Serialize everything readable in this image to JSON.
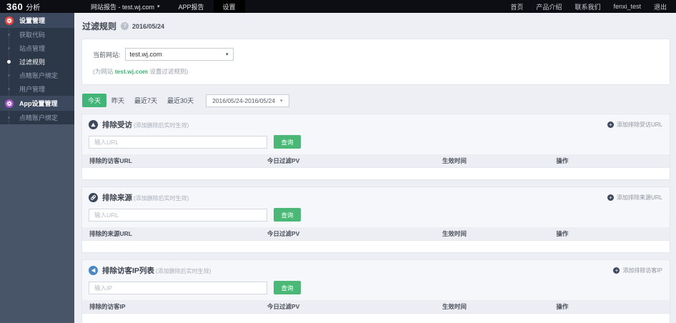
{
  "glyphs": {
    "caret": "▾",
    "question": "?",
    "plus": "+"
  },
  "colors": {
    "accent_green": "#44b478",
    "settings_gear": "#e8483f",
    "app_gear": "#a653c9",
    "section1_icon": "#3c485d",
    "section2_icon": "#3c485d",
    "section3_icon": "#4a87c7"
  },
  "topbar": {
    "logo_brand": "360",
    "logo_suffix": "分析",
    "nav": [
      {
        "label": "网站报告 - test.wj.com"
      },
      {
        "label": "APP报告"
      },
      {
        "label": "设置"
      }
    ],
    "links": [
      "首页",
      "产品介绍",
      "联系我们",
      "fenxi_test",
      "退出"
    ]
  },
  "sidebar": {
    "groups": [
      {
        "header": "设置管理",
        "items": [
          "获取代码",
          "站点管理",
          "过滤规则",
          "点睛账户绑定",
          "用户管理"
        ],
        "active_item": "过滤规则"
      },
      {
        "header": "App设置管理",
        "items": [
          "点睛账户绑定"
        ]
      }
    ]
  },
  "main": {
    "title": "过滤规则",
    "date": "2016/05/24",
    "site": {
      "label": "当前网站:",
      "selected": "test.wj.com",
      "note_prefix": "(为网站 ",
      "note_site": "test.wj.com",
      "note_suffix": " 设置过滤规则)"
    },
    "filters": {
      "tabs": [
        "今天",
        "昨天",
        "最近7天",
        "最近30天"
      ],
      "active_tab": "今天",
      "range": "2016/05/24-2016/05/24"
    },
    "sections": [
      {
        "title": "排除受访",
        "hint": "(添加删除后实时生效)",
        "input_placeholder": "输入URL",
        "search_label": "查询",
        "add_label": "添加排除受访URL",
        "columns": [
          "排除的访客URL",
          "今日过滤PV",
          "生效时间",
          "操作"
        ]
      },
      {
        "title": "排除来源",
        "hint": "(添加删除后实时生效)",
        "input_placeholder": "输入URL",
        "search_label": "查询",
        "add_label": "添加排除来源URL",
        "columns": [
          "排除的来源URL",
          "今日过滤PV",
          "生效时间",
          "操作"
        ]
      },
      {
        "title": "排除访客IP列表",
        "hint": "(添加删除后实时生效)",
        "input_placeholder": "输入IP",
        "search_label": "查询",
        "add_label": "添加排除访客IP",
        "columns": [
          "排除的访客IP",
          "今日过滤PV",
          "生效时间",
          "操作"
        ]
      }
    ]
  }
}
